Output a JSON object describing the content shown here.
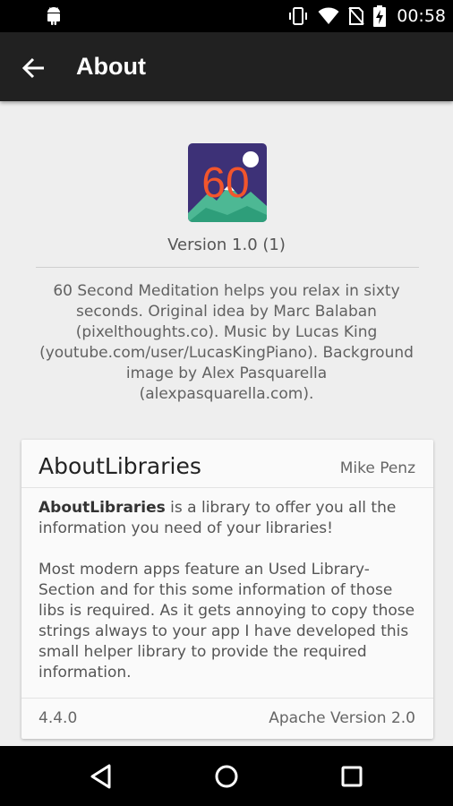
{
  "status_bar": {
    "time": "00:58",
    "icons": [
      "android-icon",
      "vibrate-icon",
      "wifi-icon",
      "no-sim-icon",
      "battery-charging-icon"
    ]
  },
  "app_bar": {
    "title": "About",
    "back_icon": "arrow-back-icon"
  },
  "app_info": {
    "icon_text": "60",
    "version": "Version 1.0 (1)",
    "description": "60 Second Meditation helps you relax in sixty seconds. Original idea by Marc Balaban (pixelthoughts.co). Music by Lucas King (youtube.com/user/LucasKingPiano). Background image by Alex Pasquarella (alexpasquarella.com)."
  },
  "library_card": {
    "name": "AboutLibraries",
    "author": "Mike Penz",
    "description_bold": "AboutLibraries",
    "description_rest": " is a library to offer you all the information you need of your libraries!",
    "description_second": "Most modern apps feature an Used Library-Section and for this some information of those libs is required. As it gets annoying to copy those strings always to your app I have developed this small helper library to provide the required information.",
    "version": "4.4.0",
    "license": "Apache Version 2.0"
  },
  "nav_bar": {
    "buttons": [
      "back-triangle-icon",
      "home-circle-icon",
      "recents-square-icon"
    ]
  },
  "colors": {
    "app_bar": "#212121",
    "background": "#eeeeee",
    "icon_bg": "#3d3177",
    "icon_number": "#f2552c",
    "icon_mountain": "#4db894"
  }
}
